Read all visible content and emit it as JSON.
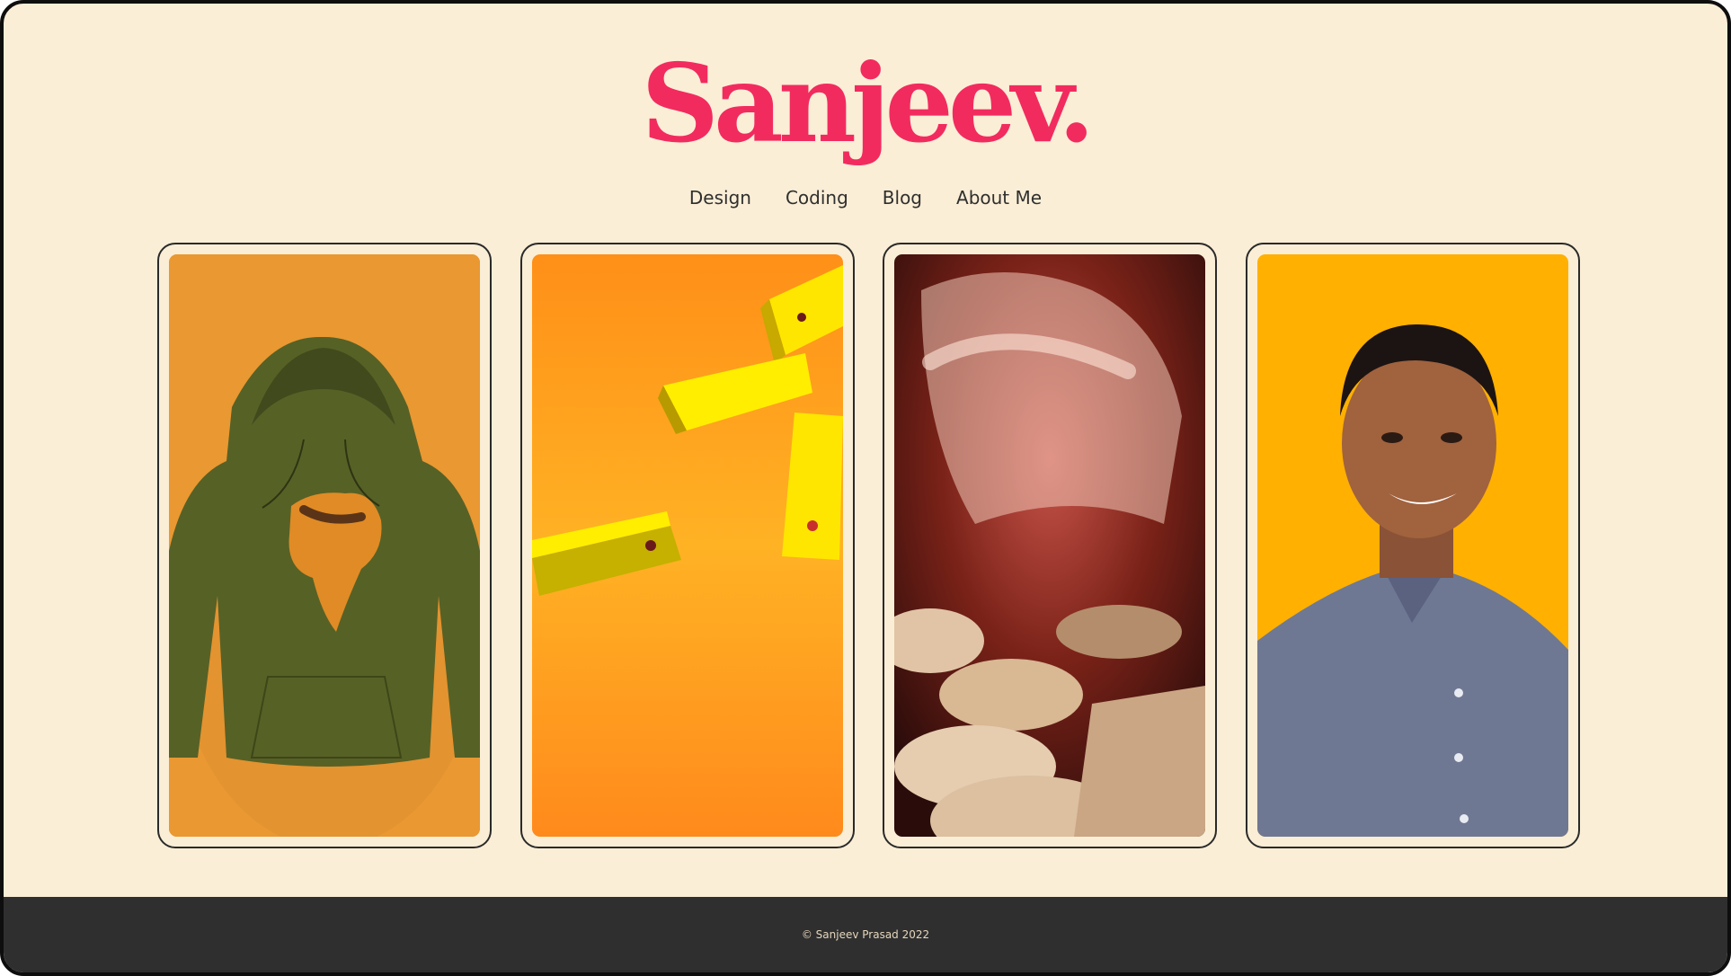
{
  "site": {
    "logo": "Sanjeev."
  },
  "nav": [
    {
      "label": "Design"
    },
    {
      "label": "Coding"
    },
    {
      "label": "Blog"
    },
    {
      "label": "About Me"
    }
  ],
  "cards": [
    {
      "subject": "hoodie-artwork",
      "bg": "#e99832"
    },
    {
      "subject": "yellow-blocks-animation",
      "bg": "#ffa81e"
    },
    {
      "subject": "keyboard-typing-closeup",
      "bg": "#3a1410"
    },
    {
      "subject": "portrait",
      "bg": "#ffb000"
    }
  ],
  "footer": {
    "copyright": "© Sanjeev Prasad 2022"
  },
  "colors": {
    "accent": "#f22b5f",
    "background": "#fbeed6",
    "footer": "#2f2f2f"
  }
}
